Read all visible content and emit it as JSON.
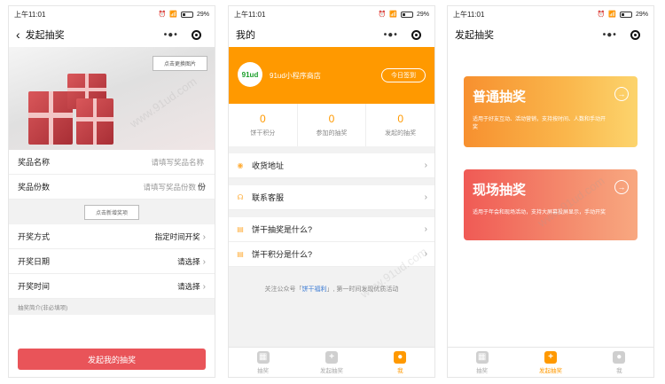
{
  "status_bar": {
    "time": "上午11:01",
    "battery": "29%"
  },
  "screen1": {
    "title": "发起抽奖",
    "change_image_btn": "点击更换图片",
    "fields": [
      {
        "label": "奖品名称",
        "value": "请填写奖品名称",
        "unit": ""
      },
      {
        "label": "奖品份数",
        "value": "请填写奖品份数",
        "unit": "份"
      }
    ],
    "add_prize_btn": "点击新增奖项",
    "options": [
      {
        "label": "开奖方式",
        "value": "指定时间开奖"
      },
      {
        "label": "开奖日期",
        "value": "请选择"
      },
      {
        "label": "开奖时间",
        "value": "请选择"
      }
    ],
    "intro_label": "抽奖简介(非必填项)",
    "submit_btn": "发起我的抽奖"
  },
  "screen2": {
    "title": "我的",
    "logo_text": "91ud",
    "shop_name": "91ud小程序商店",
    "checkin_btn": "今日签到",
    "stats": [
      {
        "value": "0",
        "label": "饼干积分"
      },
      {
        "value": "0",
        "label": "参加的抽奖"
      },
      {
        "value": "0",
        "label": "发起的抽奖"
      }
    ],
    "menu": [
      {
        "label": "收货地址",
        "icon": "location-icon"
      },
      {
        "label": "联系客服",
        "icon": "headset-icon"
      },
      {
        "label": "饼干抽奖是什么?",
        "icon": "document-icon"
      },
      {
        "label": "饼干积分是什么?",
        "icon": "document-icon"
      }
    ],
    "follow_prefix": "关注公众号「",
    "follow_account": "饼干福利",
    "follow_suffix": "」, 第一时间发现优质活动"
  },
  "screen3": {
    "title": "发起抽奖",
    "cards": [
      {
        "title": "普通抽奖",
        "desc": "适用于好友互动、活动营销，支持按时间、人数和手动开奖"
      },
      {
        "title": "现场抽奖",
        "desc": "适用于年会和现场活动，支持大屏幕投屏显示，手动开奖"
      }
    ]
  },
  "tabs": [
    "抽奖",
    "发起抽奖",
    "我"
  ],
  "watermark": "www.91ud.com",
  "colors": {
    "accent": "#ff9900",
    "submit": "#e95459",
    "link": "#3b7bd4"
  }
}
